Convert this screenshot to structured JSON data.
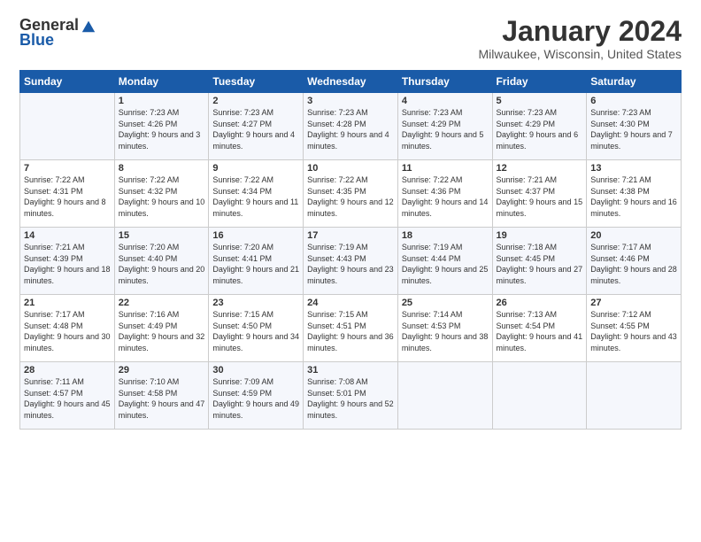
{
  "header": {
    "logo_general": "General",
    "logo_blue": "Blue",
    "month_title": "January 2024",
    "location": "Milwaukee, Wisconsin, United States"
  },
  "days_of_week": [
    "Sunday",
    "Monday",
    "Tuesday",
    "Wednesday",
    "Thursday",
    "Friday",
    "Saturday"
  ],
  "weeks": [
    [
      {
        "day": "",
        "sunrise": "",
        "sunset": "",
        "daylight": ""
      },
      {
        "day": "1",
        "sunrise": "Sunrise: 7:23 AM",
        "sunset": "Sunset: 4:26 PM",
        "daylight": "Daylight: 9 hours and 3 minutes."
      },
      {
        "day": "2",
        "sunrise": "Sunrise: 7:23 AM",
        "sunset": "Sunset: 4:27 PM",
        "daylight": "Daylight: 9 hours and 4 minutes."
      },
      {
        "day": "3",
        "sunrise": "Sunrise: 7:23 AM",
        "sunset": "Sunset: 4:28 PM",
        "daylight": "Daylight: 9 hours and 4 minutes."
      },
      {
        "day": "4",
        "sunrise": "Sunrise: 7:23 AM",
        "sunset": "Sunset: 4:29 PM",
        "daylight": "Daylight: 9 hours and 5 minutes."
      },
      {
        "day": "5",
        "sunrise": "Sunrise: 7:23 AM",
        "sunset": "Sunset: 4:29 PM",
        "daylight": "Daylight: 9 hours and 6 minutes."
      },
      {
        "day": "6",
        "sunrise": "Sunrise: 7:23 AM",
        "sunset": "Sunset: 4:30 PM",
        "daylight": "Daylight: 9 hours and 7 minutes."
      }
    ],
    [
      {
        "day": "7",
        "sunrise": "Sunrise: 7:22 AM",
        "sunset": "Sunset: 4:31 PM",
        "daylight": "Daylight: 9 hours and 8 minutes."
      },
      {
        "day": "8",
        "sunrise": "Sunrise: 7:22 AM",
        "sunset": "Sunset: 4:32 PM",
        "daylight": "Daylight: 9 hours and 10 minutes."
      },
      {
        "day": "9",
        "sunrise": "Sunrise: 7:22 AM",
        "sunset": "Sunset: 4:34 PM",
        "daylight": "Daylight: 9 hours and 11 minutes."
      },
      {
        "day": "10",
        "sunrise": "Sunrise: 7:22 AM",
        "sunset": "Sunset: 4:35 PM",
        "daylight": "Daylight: 9 hours and 12 minutes."
      },
      {
        "day": "11",
        "sunrise": "Sunrise: 7:22 AM",
        "sunset": "Sunset: 4:36 PM",
        "daylight": "Daylight: 9 hours and 14 minutes."
      },
      {
        "day": "12",
        "sunrise": "Sunrise: 7:21 AM",
        "sunset": "Sunset: 4:37 PM",
        "daylight": "Daylight: 9 hours and 15 minutes."
      },
      {
        "day": "13",
        "sunrise": "Sunrise: 7:21 AM",
        "sunset": "Sunset: 4:38 PM",
        "daylight": "Daylight: 9 hours and 16 minutes."
      }
    ],
    [
      {
        "day": "14",
        "sunrise": "Sunrise: 7:21 AM",
        "sunset": "Sunset: 4:39 PM",
        "daylight": "Daylight: 9 hours and 18 minutes."
      },
      {
        "day": "15",
        "sunrise": "Sunrise: 7:20 AM",
        "sunset": "Sunset: 4:40 PM",
        "daylight": "Daylight: 9 hours and 20 minutes."
      },
      {
        "day": "16",
        "sunrise": "Sunrise: 7:20 AM",
        "sunset": "Sunset: 4:41 PM",
        "daylight": "Daylight: 9 hours and 21 minutes."
      },
      {
        "day": "17",
        "sunrise": "Sunrise: 7:19 AM",
        "sunset": "Sunset: 4:43 PM",
        "daylight": "Daylight: 9 hours and 23 minutes."
      },
      {
        "day": "18",
        "sunrise": "Sunrise: 7:19 AM",
        "sunset": "Sunset: 4:44 PM",
        "daylight": "Daylight: 9 hours and 25 minutes."
      },
      {
        "day": "19",
        "sunrise": "Sunrise: 7:18 AM",
        "sunset": "Sunset: 4:45 PM",
        "daylight": "Daylight: 9 hours and 27 minutes."
      },
      {
        "day": "20",
        "sunrise": "Sunrise: 7:17 AM",
        "sunset": "Sunset: 4:46 PM",
        "daylight": "Daylight: 9 hours and 28 minutes."
      }
    ],
    [
      {
        "day": "21",
        "sunrise": "Sunrise: 7:17 AM",
        "sunset": "Sunset: 4:48 PM",
        "daylight": "Daylight: 9 hours and 30 minutes."
      },
      {
        "day": "22",
        "sunrise": "Sunrise: 7:16 AM",
        "sunset": "Sunset: 4:49 PM",
        "daylight": "Daylight: 9 hours and 32 minutes."
      },
      {
        "day": "23",
        "sunrise": "Sunrise: 7:15 AM",
        "sunset": "Sunset: 4:50 PM",
        "daylight": "Daylight: 9 hours and 34 minutes."
      },
      {
        "day": "24",
        "sunrise": "Sunrise: 7:15 AM",
        "sunset": "Sunset: 4:51 PM",
        "daylight": "Daylight: 9 hours and 36 minutes."
      },
      {
        "day": "25",
        "sunrise": "Sunrise: 7:14 AM",
        "sunset": "Sunset: 4:53 PM",
        "daylight": "Daylight: 9 hours and 38 minutes."
      },
      {
        "day": "26",
        "sunrise": "Sunrise: 7:13 AM",
        "sunset": "Sunset: 4:54 PM",
        "daylight": "Daylight: 9 hours and 41 minutes."
      },
      {
        "day": "27",
        "sunrise": "Sunrise: 7:12 AM",
        "sunset": "Sunset: 4:55 PM",
        "daylight": "Daylight: 9 hours and 43 minutes."
      }
    ],
    [
      {
        "day": "28",
        "sunrise": "Sunrise: 7:11 AM",
        "sunset": "Sunset: 4:57 PM",
        "daylight": "Daylight: 9 hours and 45 minutes."
      },
      {
        "day": "29",
        "sunrise": "Sunrise: 7:10 AM",
        "sunset": "Sunset: 4:58 PM",
        "daylight": "Daylight: 9 hours and 47 minutes."
      },
      {
        "day": "30",
        "sunrise": "Sunrise: 7:09 AM",
        "sunset": "Sunset: 4:59 PM",
        "daylight": "Daylight: 9 hours and 49 minutes."
      },
      {
        "day": "31",
        "sunrise": "Sunrise: 7:08 AM",
        "sunset": "Sunset: 5:01 PM",
        "daylight": "Daylight: 9 hours and 52 minutes."
      },
      {
        "day": "",
        "sunrise": "",
        "sunset": "",
        "daylight": ""
      },
      {
        "day": "",
        "sunrise": "",
        "sunset": "",
        "daylight": ""
      },
      {
        "day": "",
        "sunrise": "",
        "sunset": "",
        "daylight": ""
      }
    ]
  ]
}
